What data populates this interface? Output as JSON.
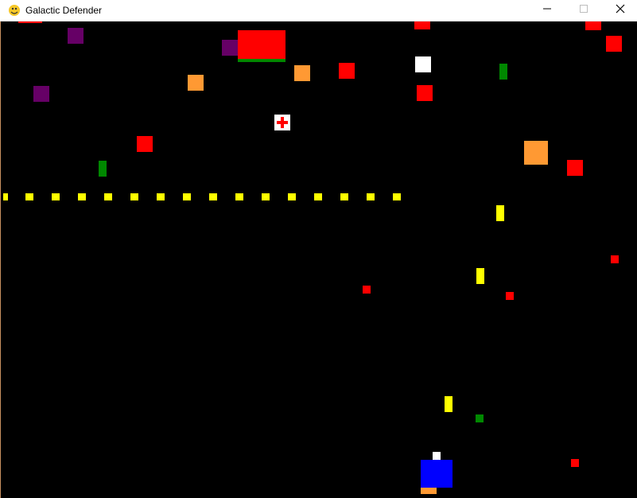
{
  "window": {
    "title": "Galactic Defender",
    "icon": "pygame-snake-icon",
    "controls": [
      "minimize-icon",
      "maximize-icon",
      "close-icon"
    ]
  },
  "game": {
    "background_color": "#000000",
    "colors": {
      "enemy_red": "#ff0000",
      "enemy_orange": "#ff9933",
      "enemy_purple": "#660066",
      "powerup_green": "#008800",
      "boss_health": "#008800",
      "bullet_yellow": "#ffff00",
      "player_blue": "#0000ff",
      "player_thruster": "#ff9933",
      "white": "#ffffff",
      "health_pickup": "#ffffff"
    },
    "boss": {
      "health_fraction": 1.0
    }
  }
}
